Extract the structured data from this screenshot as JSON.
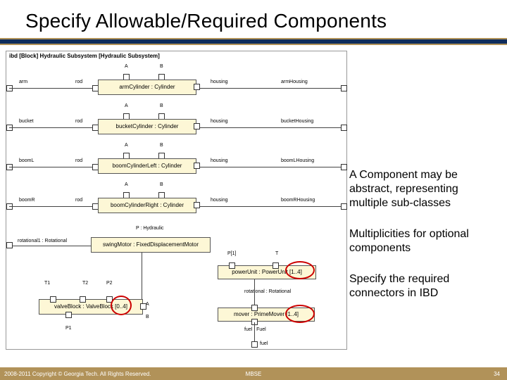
{
  "title": "Specify Allowable/Required Components",
  "diagram_label": "ibd [Block] Hydraulic Subsystem [Hydraulic Subsystem]",
  "rows": [
    {
      "left": "arm",
      "mid": "rod",
      "block": "armCylinder : Cylinder",
      "rlabel": "housing",
      "right": "armHousing"
    },
    {
      "left": "bucket",
      "mid": "rod",
      "block": "bucketCylinder : Cylinder",
      "rlabel": "housing",
      "right": "bucketHousing"
    },
    {
      "left": "boomL",
      "mid": "rod",
      "block": "boomCylinderLeft : Cylinder",
      "rlabel": "housing",
      "right": "boomLHousing"
    },
    {
      "left": "boomR",
      "mid": "rod",
      "block": "boomCylinderRight : Cylinder",
      "rlabel": "housing",
      "right": "boomRHousing"
    }
  ],
  "swing_block": "swingMotor : FixedDisplacementMotor",
  "swing_left": "rotational1 : Rotational",
  "swing_right": "",
  "swing_top": "P : Hydraulic",
  "valve_block": "valveBlock : ValveBlock [0..4]",
  "valve_p1": "P1",
  "valve_p2": "P2",
  "valve_t1": "T1",
  "valve_t2": "T2",
  "valve_a": "A",
  "valve_b": "B",
  "power_block": "powerUnit : PowerUnit [1..4]",
  "power_p": "P[1]",
  "power_t": "T",
  "mover_block": "mover : PrimeMover [1..4]",
  "mover_rot": "rotational : Rotational",
  "mover_fuel": "fuel : Fuel",
  "notes": [
    "A Component may be abstract, representing multiple sub-classes",
    "Multiplicities for optional components",
    "Specify the required connectors in IBD"
  ],
  "footer": {
    "copyright": "2008-2011 Copyright © Georgia Tech. All Rights Reserved.",
    "center": "MBSE",
    "page": "34"
  }
}
